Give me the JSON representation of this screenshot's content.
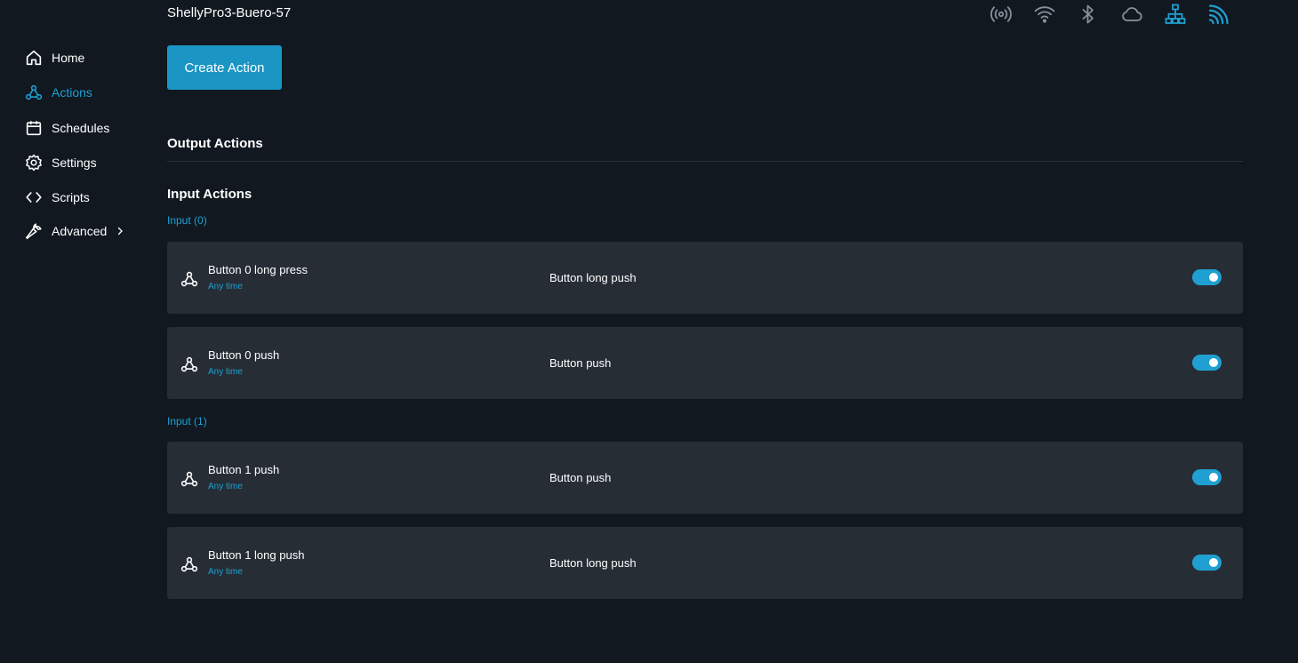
{
  "header": {
    "device_name": "ShellyPro3-Buero-57"
  },
  "status_icons": [
    "antenna-icon",
    "wifi-icon",
    "bluetooth-icon",
    "cloud-icon",
    "ethernet-icon",
    "mqtt-icon"
  ],
  "colors": {
    "background": "#111820",
    "card": "#272d35",
    "accent": "#1f9fd2",
    "button": "#1a95c4",
    "icon_gray": "#8a9099"
  },
  "sidebar": {
    "items": [
      {
        "label": "Home",
        "icon": "home-icon"
      },
      {
        "label": "Actions",
        "icon": "webhook-icon",
        "active": true
      },
      {
        "label": "Schedules",
        "icon": "calendar-icon"
      },
      {
        "label": "Settings",
        "icon": "gear-icon"
      },
      {
        "label": "Scripts",
        "icon": "code-icon"
      },
      {
        "label": "Advanced",
        "icon": "wrench-icon",
        "has_submenu": true
      }
    ]
  },
  "main": {
    "create_button": "Create Action",
    "output_title": "Output Actions",
    "input_title": "Input Actions",
    "groups": [
      {
        "label": "Input (0)",
        "actions": [
          {
            "name": "Button 0 long press",
            "schedule": "Any time",
            "event": "Button long push",
            "enabled": true
          },
          {
            "name": "Button 0 push",
            "schedule": "Any time",
            "event": "Button push",
            "enabled": true
          }
        ]
      },
      {
        "label": "Input (1)",
        "actions": [
          {
            "name": "Button 1 push",
            "schedule": "Any time",
            "event": "Button push",
            "enabled": true
          },
          {
            "name": "Button 1 long push",
            "schedule": "Any time",
            "event": "Button long push",
            "enabled": true
          }
        ]
      }
    ]
  }
}
